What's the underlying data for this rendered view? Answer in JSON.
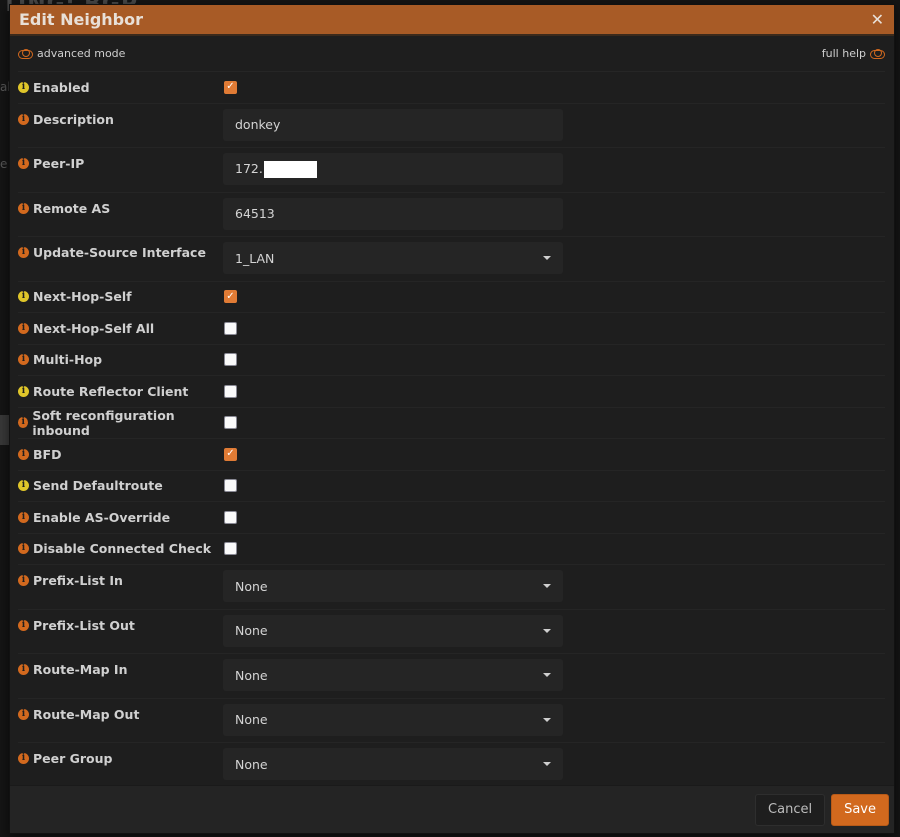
{
  "background": {
    "page_title_fragment": "TING: BGP",
    "left_fragments": [
      "al",
      "e"
    ]
  },
  "modal": {
    "title": "Edit Neighbor",
    "close_icon": "close-icon",
    "advanced_mode_label": "advanced mode",
    "full_help_label": "full help",
    "accent_color": "#d2691e",
    "header_color": "#a85b26"
  },
  "fields": [
    {
      "id": "enabled",
      "label": "Enabled",
      "type": "checkbox",
      "checked": true,
      "icon_color": "yellow"
    },
    {
      "id": "description",
      "label": "Description",
      "type": "text",
      "value": "donkey",
      "icon_color": "orange"
    },
    {
      "id": "peer-ip",
      "label": "Peer-IP",
      "type": "text",
      "value": "172.",
      "redacted": true,
      "icon_color": "orange"
    },
    {
      "id": "remote-as",
      "label": "Remote AS",
      "type": "text",
      "value": "64513",
      "icon_color": "orange"
    },
    {
      "id": "update-source-interface",
      "label": "Update-Source Interface",
      "type": "select",
      "value": "1_LAN",
      "icon_color": "orange"
    },
    {
      "id": "next-hop-self",
      "label": "Next-Hop-Self",
      "type": "checkbox",
      "checked": true,
      "icon_color": "yellow"
    },
    {
      "id": "next-hop-self-all",
      "label": "Next-Hop-Self All",
      "type": "checkbox",
      "checked": false,
      "icon_color": "orange"
    },
    {
      "id": "multi-hop",
      "label": "Multi-Hop",
      "type": "checkbox",
      "checked": false,
      "icon_color": "orange"
    },
    {
      "id": "route-reflector-client",
      "label": "Route Reflector Client",
      "type": "checkbox",
      "checked": false,
      "icon_color": "yellow"
    },
    {
      "id": "soft-reconfiguration-inbound",
      "label": "Soft reconfiguration inbound",
      "type": "checkbox",
      "checked": false,
      "icon_color": "orange"
    },
    {
      "id": "bfd",
      "label": "BFD",
      "type": "checkbox",
      "checked": true,
      "icon_color": "orange"
    },
    {
      "id": "send-defaultroute",
      "label": "Send Defaultroute",
      "type": "checkbox",
      "checked": false,
      "icon_color": "yellow"
    },
    {
      "id": "enable-as-override",
      "label": "Enable AS-Override",
      "type": "checkbox",
      "checked": false,
      "icon_color": "orange"
    },
    {
      "id": "disable-connected-check",
      "label": "Disable Connected Check",
      "type": "checkbox",
      "checked": false,
      "icon_color": "orange"
    },
    {
      "id": "prefix-list-in",
      "label": "Prefix-List In",
      "type": "select",
      "value": "None",
      "icon_color": "orange"
    },
    {
      "id": "prefix-list-out",
      "label": "Prefix-List Out",
      "type": "select",
      "value": "None",
      "icon_color": "orange"
    },
    {
      "id": "route-map-in",
      "label": "Route-Map In",
      "type": "select",
      "value": "None",
      "icon_color": "orange"
    },
    {
      "id": "route-map-out",
      "label": "Route-Map Out",
      "type": "select",
      "value": "None",
      "icon_color": "orange"
    },
    {
      "id": "peer-group",
      "label": "Peer Group",
      "type": "select",
      "value": "None",
      "icon_color": "orange"
    }
  ],
  "footer": {
    "cancel_label": "Cancel",
    "save_label": "Save"
  }
}
